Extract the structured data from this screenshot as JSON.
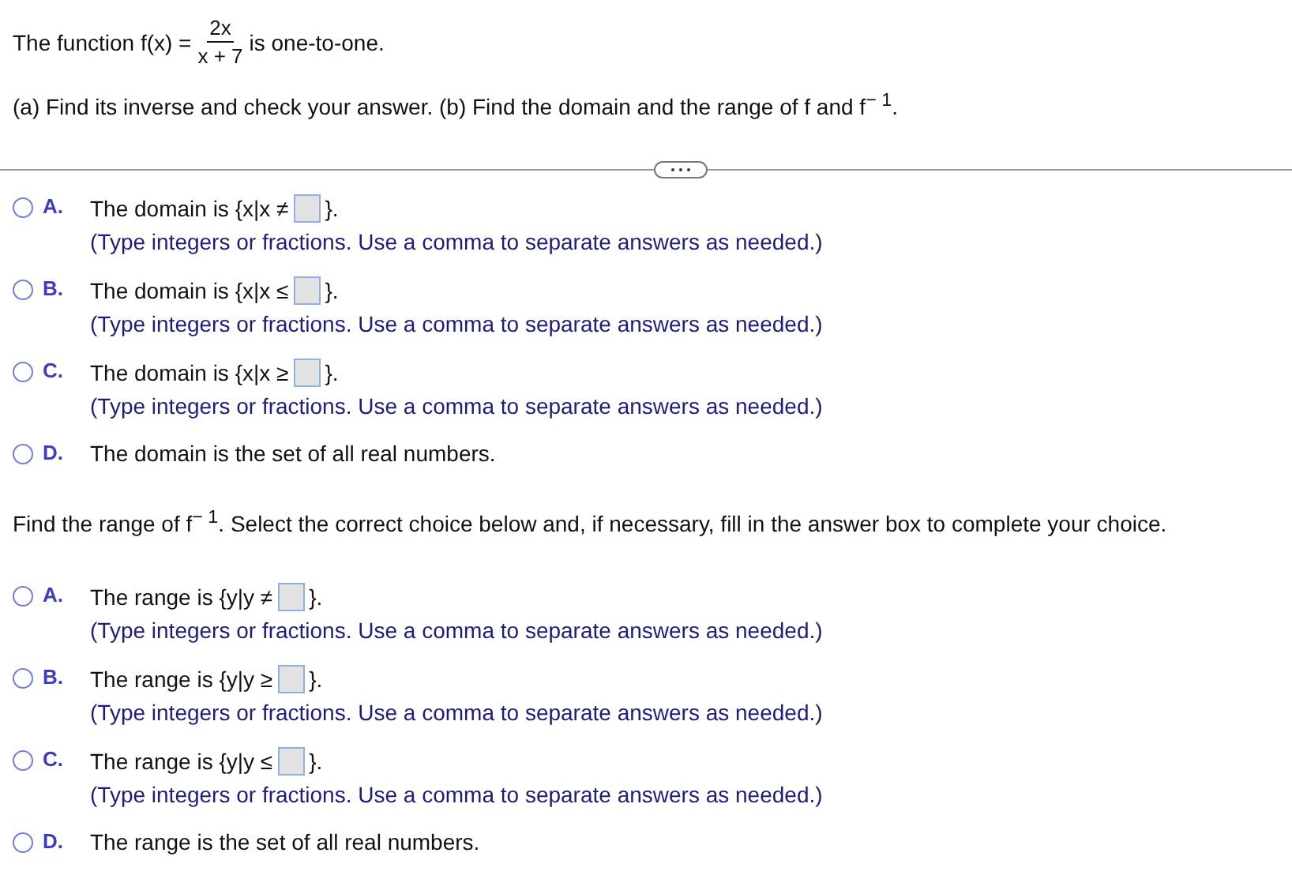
{
  "question": {
    "prefix": "The function f(x) =",
    "numerator": "2x",
    "denominator": "x + 7",
    "suffix": "is one-to-one."
  },
  "instruction": "(a) Find its inverse and check your answer. (b) Find the domain and the range of f and f$^{− 1}$.",
  "domain_choices": [
    {
      "letter": "A.",
      "selected": false,
      "kind": "box",
      "before": "The domain is {x|x ≠",
      "after": "}.",
      "note": "(Type integers or fractions. Use a comma to separate answers as needed.)"
    },
    {
      "letter": "B.",
      "selected": false,
      "kind": "box",
      "before": "The domain is {x|x ≤",
      "after": "}.",
      "note": "(Type integers or fractions. Use a comma to separate answers as needed.)"
    },
    {
      "letter": "C.",
      "selected": false,
      "kind": "box",
      "before": "The domain is {x|x ≥",
      "after": "}.",
      "note": "(Type integers or fractions. Use a comma to separate answers as needed.)"
    },
    {
      "letter": "D.",
      "selected": false,
      "kind": "plain",
      "before": "The domain is the set of all real numbers."
    }
  ],
  "range_prompt": "Find the range of f$^{− 1}$. Select the correct choice below and, if necessary, fill in the answer box to complete your choice.",
  "range_choices": [
    {
      "letter": "A.",
      "selected": false,
      "kind": "box",
      "before": "The range is {y|y ≠",
      "after": "}.",
      "note": "(Type integers or fractions. Use a comma to separate answers as needed.)"
    },
    {
      "letter": "B.",
      "selected": false,
      "kind": "box",
      "before": "The range is {y|y ≥",
      "after": "}.",
      "note": "(Type integers or fractions. Use a comma to separate answers as needed.)"
    },
    {
      "letter": "C.",
      "selected": false,
      "kind": "box",
      "before": "The range is {y|y ≤",
      "after": "}.",
      "note": "(Type integers or fractions. Use a comma to separate answers as needed.)"
    },
    {
      "letter": "D.",
      "selected": false,
      "kind": "plain",
      "before": "The range is the set of all real numbers."
    }
  ]
}
